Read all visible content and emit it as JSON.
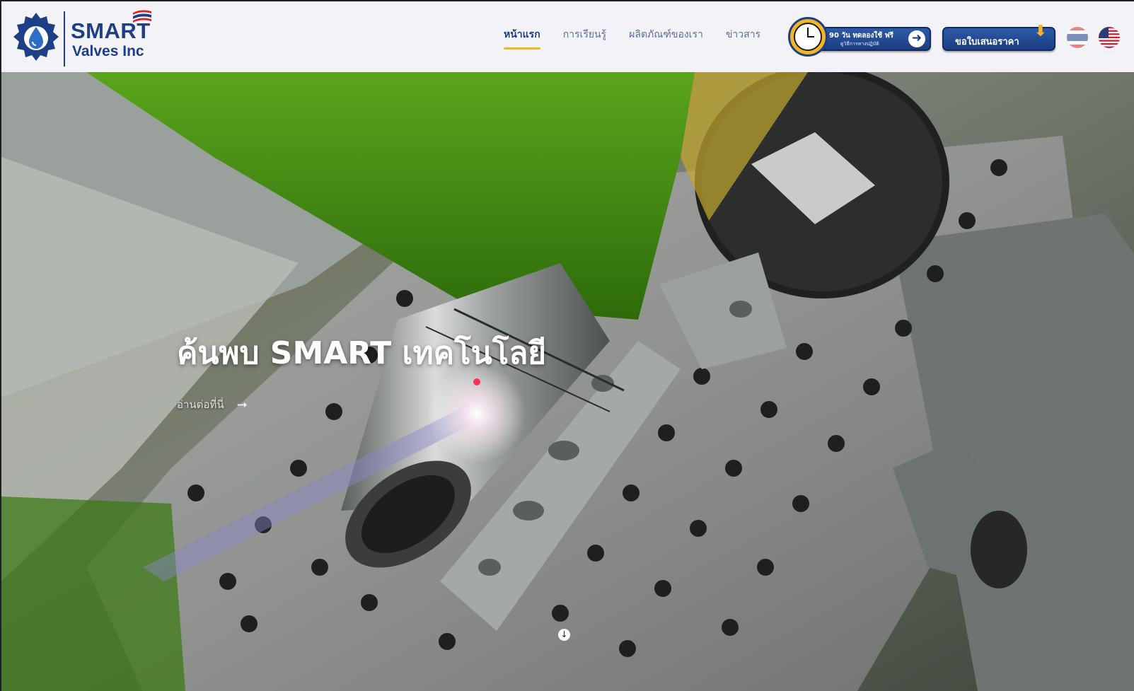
{
  "brand": {
    "name_line1": "SMART",
    "name_line2": "Valves Inc"
  },
  "nav": {
    "items": [
      {
        "label": "หน้าแรก",
        "active": true
      },
      {
        "label": "การเรียนรู้",
        "active": false
      },
      {
        "label": "ผลิตภัณฑ์ของเรา",
        "active": false
      },
      {
        "label": "ข่าวสาร",
        "active": false
      }
    ]
  },
  "trial_button": {
    "title": "90 วัน ทดลองใช้ ฟรี",
    "subtitle": "ดูวิธีการทางปฏิบัติ",
    "arrow": "➜"
  },
  "quote_button": {
    "label": "ขอใบเสนอราคา",
    "arrow": "⬇"
  },
  "languages": [
    {
      "code": "th",
      "icon": "thai-flag-icon",
      "active": false
    },
    {
      "code": "en",
      "icon": "us-flag-icon",
      "active": true
    }
  ],
  "hero": {
    "title": "ค้นพบ SMART เทคโนโลยี",
    "link_label": "อ่านต่อที่นี่",
    "link_arrow": "➞",
    "scroll_icon": "↓"
  },
  "colors": {
    "brand_blue": "#1d3f86",
    "accent_yellow": "#f2b526",
    "header_bg": "#f3f3f7"
  }
}
